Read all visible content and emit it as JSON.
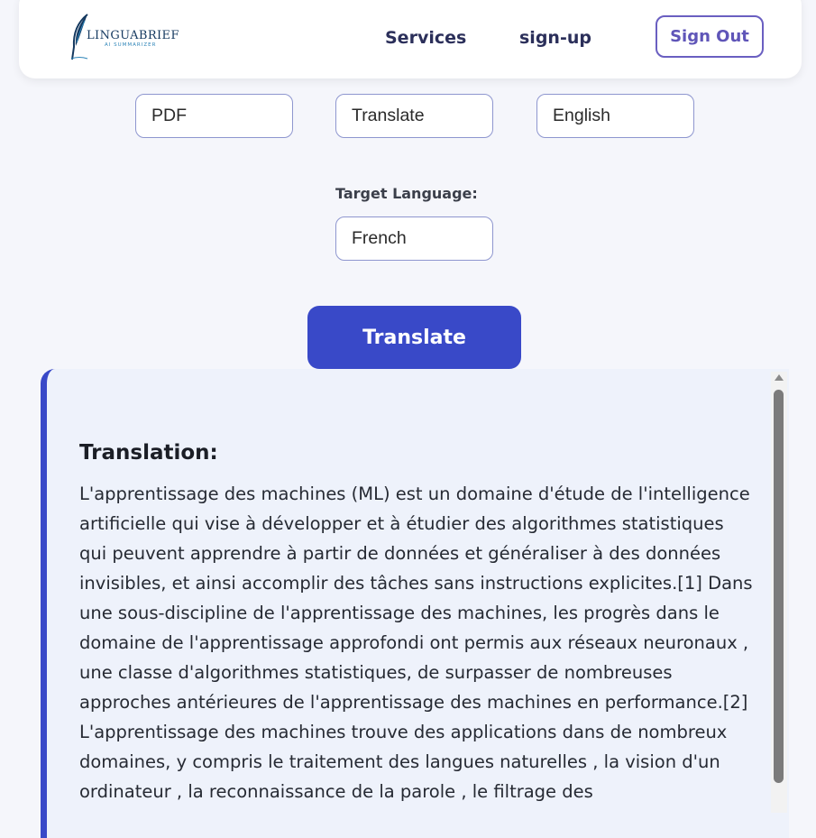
{
  "nav": {
    "logo_title": "LINGUABRIEF",
    "logo_subtitle": "AI SUMMARIZER",
    "links": [
      {
        "label": "Services"
      },
      {
        "label": "sign-up"
      }
    ],
    "signout_label": "Sign Out"
  },
  "form": {
    "file_type": {
      "value": "PDF"
    },
    "operation": {
      "value": "Translate"
    },
    "source_language": {
      "value": "English"
    },
    "target_language": {
      "label": "Target Language:",
      "value": "French"
    },
    "submit_label": "Translate"
  },
  "result": {
    "title": "Translation:",
    "text": "L'apprentissage des machines (ML) est un domaine d'étude de l'intelligence artificielle qui vise à développer et à étudier des algorithmes statistiques qui peuvent apprendre à partir de données et généraliser à des données invisibles, et ainsi accomplir des tâches sans instructions explicites.[1] Dans une sous-discipline de l'apprentissage des machines, les progrès dans le domaine de l'apprentissage approfondi ont permis aux réseaux neuronaux , une classe d'algorithmes statistiques, de surpasser de nombreuses approches antérieures de l'apprentissage des machines en performance.[2] L'apprentissage des machines trouve des applications dans de nombreux domaines, y compris le traitement des langues naturelles , la vision d'un ordinateur , la reconnaissance de la parole , le filtrage des"
  },
  "colors": {
    "accent": "#3949c8",
    "nav_text": "#2b2f5a",
    "signout_border": "#6a5fc1",
    "panel_bg": "#eef2fb",
    "page_bg": "#f5f6fb"
  },
  "icons": {
    "logo": "quill-feather-icon",
    "scroll_up": "scroll-up-arrow-icon"
  }
}
